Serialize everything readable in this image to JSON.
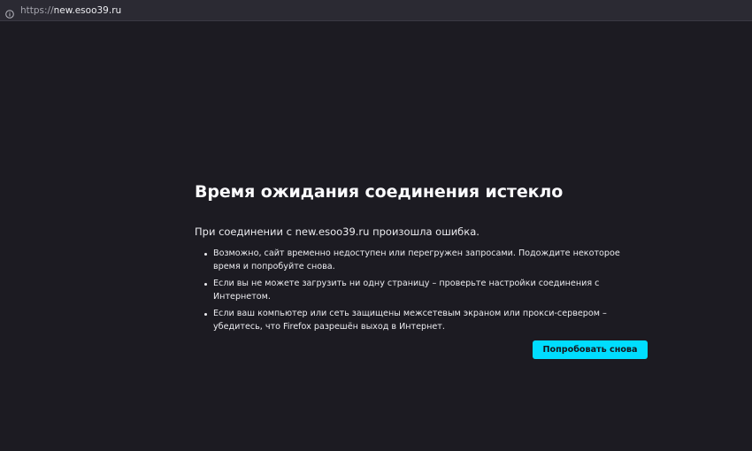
{
  "urlbar": {
    "icon": "info-icon",
    "scheme": "https://",
    "host": "new.esoo39.ru"
  },
  "error": {
    "title": "Время ожидания соединения истекло",
    "intro": "При соединении с new.esoo39.ru произошла ошибка.",
    "items": [
      "Возможно, сайт временно недоступен или перегружен запросами. Подождите некоторое время и попробуйте снова.",
      "Если вы не можете загрузить ни одну страницу – проверьте настройки соединения с Интернетом.",
      "Если ваш компьютер или сеть защищены межсетевым экраном или прокси-сервером – убедитесь, что Firefox разрешён выход в Интернет."
    ],
    "retry_label": "Попробовать снова"
  },
  "colors": {
    "page_background": "#1c1b22",
    "urlbar_background": "#2b2a33",
    "accent": "#00ddff",
    "text": "#fbfbfe"
  }
}
